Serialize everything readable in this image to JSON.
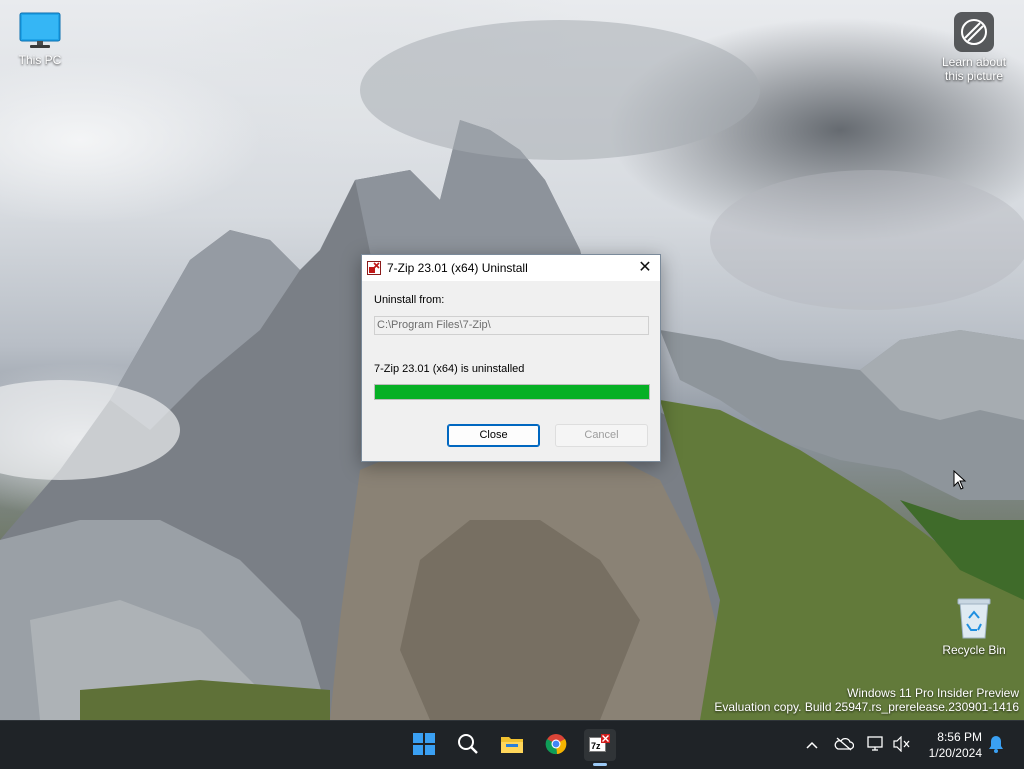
{
  "desktop": {
    "icons": [
      {
        "label": "This PC",
        "icon": "monitor-icon"
      },
      {
        "label": "Learn about\nthis picture",
        "icon": "camera-icon"
      },
      {
        "label": "Recycle Bin",
        "icon": "recycle-bin-icon"
      }
    ],
    "watermark": {
      "line1": "Windows 11 Pro Insider Preview",
      "line2": "Evaluation copy. Build 25947.rs_prerelease.230901-1416"
    }
  },
  "dialog": {
    "title": "7-Zip 23.01 (x64) Uninstall",
    "uninstall_from_label": "Uninstall from:",
    "path_value": "C:\\Program Files\\7-Zip\\",
    "status_text": "7-Zip 23.01 (x64) is uninstalled",
    "progress_percent": 100,
    "close_label": "Close",
    "cancel_label": "Cancel",
    "close_glyph": "✕"
  },
  "taskbar": {
    "apps": [
      "start-icon",
      "search-icon",
      "file-explorer-icon",
      "chrome-icon",
      "7zip-uninstall-icon"
    ],
    "active_app": "7zip-uninstall-icon",
    "tray_icons": [
      "chevron-up-icon",
      "onedrive-icon",
      "network-icon",
      "volume-muted-icon",
      "notification-bell-icon"
    ],
    "time": "8:56 PM",
    "date": "1/20/2024"
  },
  "colors": {
    "progress_fill": "#06b025",
    "button_focus": "#0067c0",
    "taskbar_bg": "#1f2327"
  }
}
